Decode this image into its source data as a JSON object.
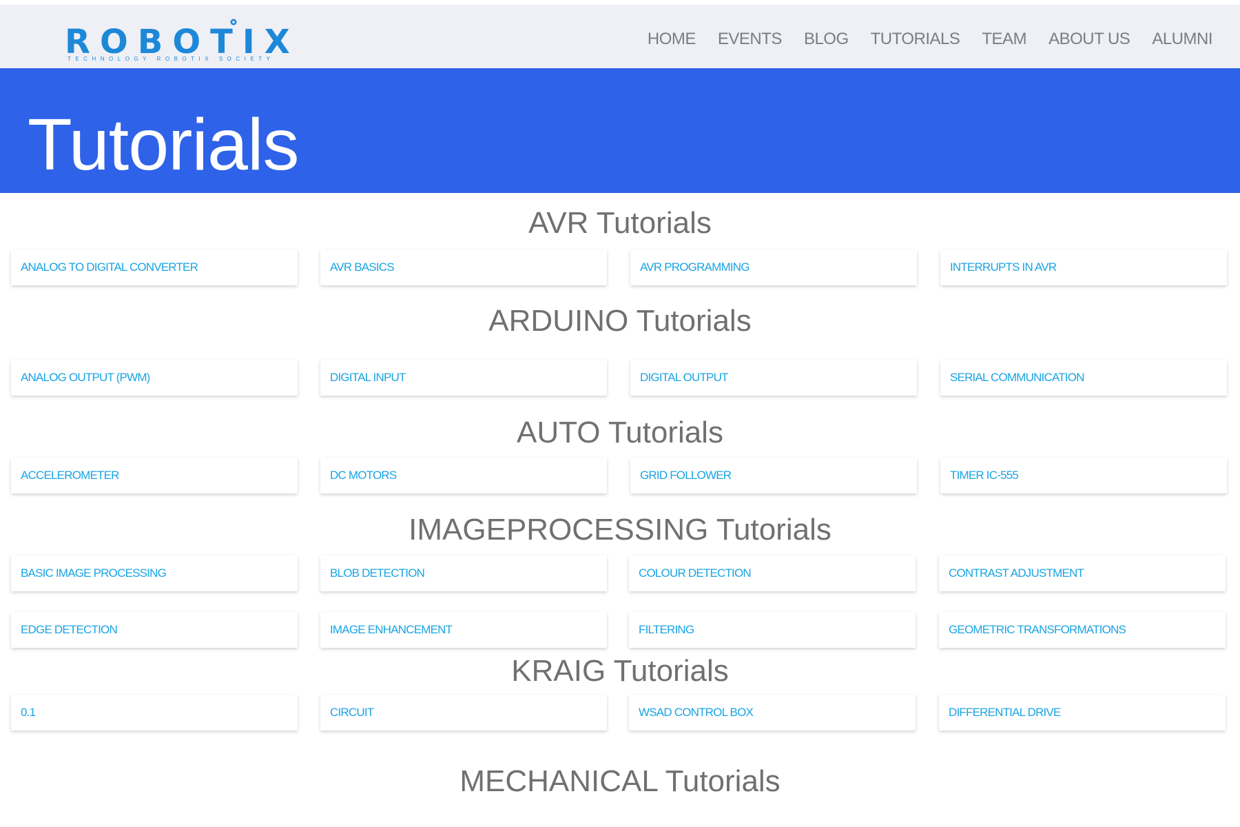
{
  "logo": {
    "wordmark": "ROBOTIX",
    "tagline": "TECHNOLOGY ROBOTIX SOCIETY",
    "color": "#1e88d8"
  },
  "nav": [
    "HOME",
    "EVENTS",
    "BLOG",
    "TUTORIALS",
    "TEAM",
    "ABOUT US",
    "ALUMNI"
  ],
  "hero": {
    "title": "Tutorials",
    "color": "#2e62e9"
  },
  "sections": [
    {
      "title": "AVR Tutorials",
      "items": [
        "ANALOG TO DIGITAL CONVERTER",
        "AVR BASICS",
        "AVR PROGRAMMING",
        "INTERRUPTS IN AVR"
      ]
    },
    {
      "title": "ARDUINO Tutorials",
      "items": [
        "ANALOG OUTPUT (PWM)",
        "DIGITAL INPUT",
        "DIGITAL OUTPUT",
        "SERIAL COMMUNICATION"
      ]
    },
    {
      "title": "AUTO Tutorials",
      "items": [
        "ACCELEROMETER",
        "DC MOTORS",
        "GRID FOLLOWER",
        "TIMER IC-555"
      ]
    },
    {
      "title": "IMAGEPROCESSING Tutorials",
      "items": [
        "BASIC IMAGE PROCESSING",
        "BLOB DETECTION",
        "COLOUR DETECTION",
        "CONTRAST ADJUSTMENT",
        "EDGE DETECTION",
        "IMAGE ENHANCEMENT",
        "FILTERING",
        "GEOMETRIC TRANSFORMATIONS"
      ]
    },
    {
      "title": "KRAIG Tutorials",
      "items": [
        "0.1",
        "CIRCUIT",
        "WSAD CONTROL BOX",
        "DIFFERENTIAL DRIVE"
      ]
    },
    {
      "title": "MECHANICAL Tutorials",
      "items": []
    }
  ],
  "link_color": "#1aa4e3"
}
